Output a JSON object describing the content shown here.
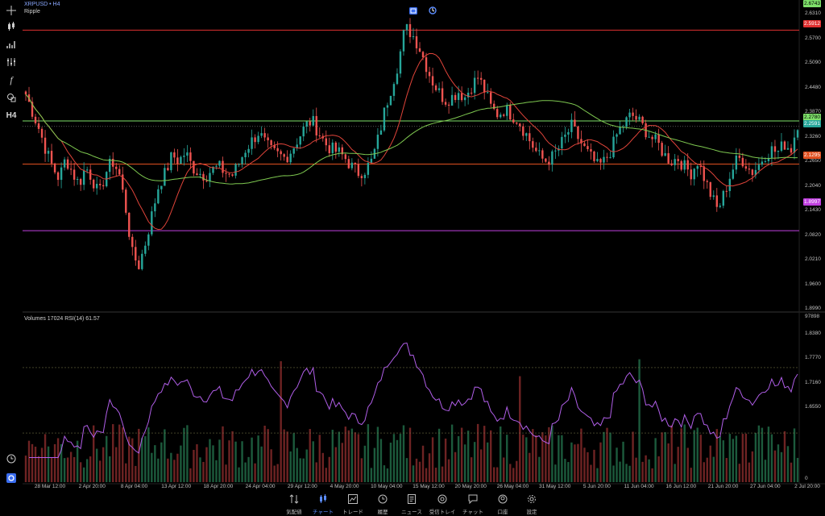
{
  "symbol": {
    "ticker": "XRPUSD",
    "dot": "•",
    "timeframe": "H4",
    "name": "Ripple"
  },
  "indicator_label": "Volumes 17024 RSI(14) 61.57",
  "timeframe_button": "H4",
  "price_axis": [
    "2.6310",
    "2.5700",
    "2.5090",
    "2.4480",
    "2.3870",
    "2.3260",
    "2.2650",
    "2.2040",
    "2.1430",
    "2.0820",
    "2.0210",
    "1.9600",
    "1.8990",
    "1.8380",
    "1.7770",
    "1.7160",
    "1.6550"
  ],
  "price_tags": {
    "top": "2.6743",
    "red_line": "2.5912",
    "green_line": "2.2780",
    "current": "2.2591",
    "orange_line": "2.1295",
    "magenta_line": "1.8997"
  },
  "indicator_axis": {
    "max": "97898",
    "min": "0"
  },
  "time_axis": [
    "28 Mar 12:00",
    "2 Apr 20:00",
    "8 Apr 04:00",
    "13 Apr 12:00",
    "18 Apr 20:00",
    "24 Apr 04:00",
    "29 Apr 12:00",
    "4 May 20:00",
    "10 May 04:00",
    "15 May 12:00",
    "20 May 20:00",
    "26 May 04:00",
    "31 May 12:00",
    "5 Jun 20:00",
    "11 Jun 04:00",
    "16 Jun 12:00",
    "21 Jun 20:00",
    "27 Jun 04:00",
    "2 Jul 20:00"
  ],
  "bottom_nav": [
    {
      "label": "気配値",
      "icon": "quotes-icon"
    },
    {
      "label": "チャート",
      "icon": "chart-icon",
      "active": true
    },
    {
      "label": "トレード",
      "icon": "trade-icon"
    },
    {
      "label": "履歴",
      "icon": "history-icon"
    },
    {
      "label": "ニュース",
      "icon": "news-icon"
    },
    {
      "label": "受信トレイ",
      "icon": "inbox-icon"
    },
    {
      "label": "チャット",
      "icon": "chat-icon"
    },
    {
      "label": "口座",
      "icon": "account-icon"
    },
    {
      "label": "設定",
      "icon": "settings-icon"
    }
  ],
  "colors": {
    "accent": "#5b8cff",
    "bull": "#26a69a",
    "bear": "#ef5350",
    "rsi": "#b05ee8",
    "ma_fast": "#e0443a",
    "ma_slow": "#7ec850",
    "hline_red": "#e03030",
    "hline_green": "#7ee06a",
    "hline_orange": "#e05020",
    "hline_magenta": "#c040e0"
  },
  "chart_data": {
    "type": "candlestick",
    "price_range": [
      1.625,
      2.695
    ],
    "close_series": [
      2.37,
      2.31,
      2.25,
      2.18,
      2.12,
      2.08,
      2.15,
      2.1,
      2.06,
      2.12,
      2.08,
      2.02,
      2.1,
      2.14,
      2.1,
      1.98,
      1.82,
      1.78,
      1.86,
      1.96,
      2.06,
      2.1,
      2.16,
      2.14,
      2.17,
      2.12,
      2.1,
      2.09,
      2.11,
      2.12,
      2.1,
      2.09,
      2.13,
      2.18,
      2.21,
      2.24,
      2.2,
      2.17,
      2.16,
      2.15,
      2.18,
      2.22,
      2.26,
      2.28,
      2.24,
      2.2,
      2.18,
      2.17,
      2.15,
      2.12,
      2.1,
      2.11,
      2.14,
      2.22,
      2.32,
      2.4,
      2.48,
      2.6,
      2.58,
      2.54,
      2.48,
      2.42,
      2.38,
      2.35,
      2.36,
      2.38,
      2.36,
      2.4,
      2.43,
      2.38,
      2.32,
      2.3,
      2.32,
      2.3,
      2.28,
      2.24,
      2.2,
      2.16,
      2.14,
      2.15,
      2.18,
      2.22,
      2.26,
      2.22,
      2.18,
      2.15,
      2.12,
      2.14,
      2.18,
      2.24,
      2.27,
      2.3,
      2.28,
      2.25,
      2.22,
      2.2,
      2.16,
      2.14,
      2.15,
      2.12,
      2.1,
      2.14,
      2.08,
      2.02,
      1.97,
      2.03,
      2.1,
      2.15,
      2.14,
      2.1,
      2.12,
      2.16,
      2.18,
      2.17,
      2.2,
      2.18,
      2.27
    ],
    "rsi": {
      "period": 14,
      "last": 61.57,
      "levels": [
        70,
        30
      ]
    },
    "volume": {
      "max": 97898
    }
  }
}
